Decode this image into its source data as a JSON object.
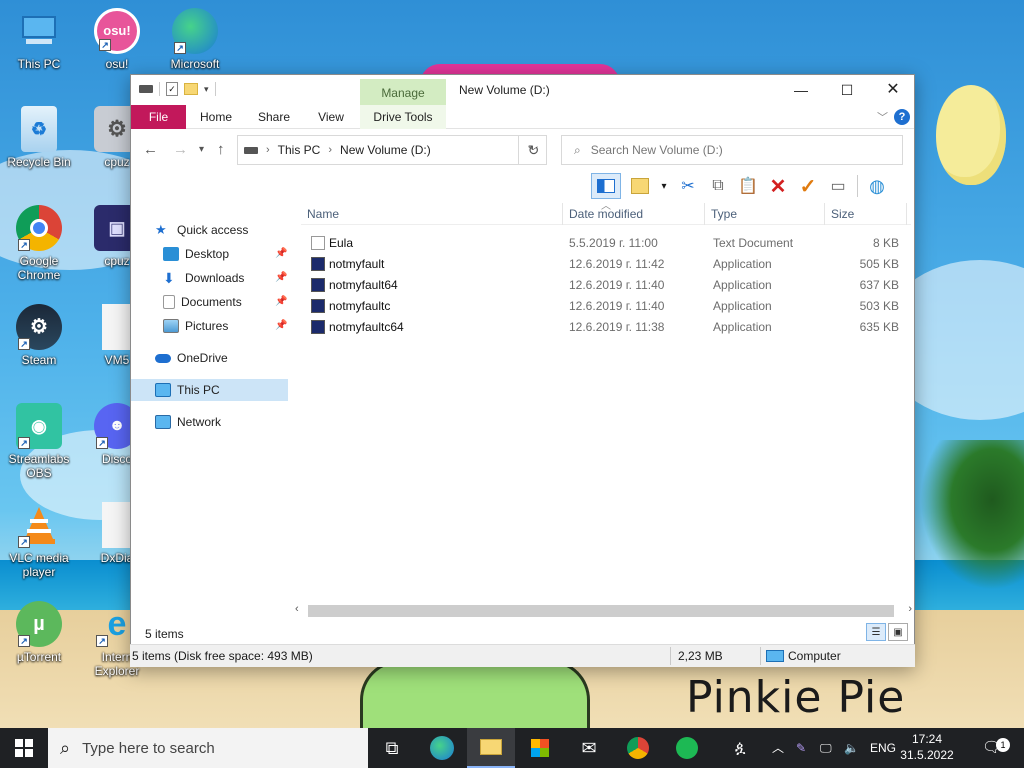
{
  "desktop": {
    "brand_text": "Pinkie Pie",
    "icons": [
      {
        "label": "This PC",
        "icon": "this-pc-icon"
      },
      {
        "label": "osu!",
        "icon": "osu-icon",
        "badge": "osu!"
      },
      {
        "label": "Microsoft",
        "icon": "edge-icon"
      },
      {
        "label": "Recycle Bin",
        "icon": "recycle-bin-icon"
      },
      {
        "label": "cpuz",
        "icon": "cpuz-icon"
      },
      {
        "label": "Google Chrome",
        "icon": "chrome-icon"
      },
      {
        "label": "cpuz",
        "icon": "cpuz-icon"
      },
      {
        "label": "Steam",
        "icon": "steam-icon"
      },
      {
        "label": "VM5",
        "icon": "document-icon"
      },
      {
        "label": "Streamlabs OBS",
        "icon": "streamlabs-icon"
      },
      {
        "label": "Disco",
        "icon": "discord-icon"
      },
      {
        "label": "VLC media player",
        "icon": "vlc-icon"
      },
      {
        "label": "DxDia",
        "icon": "document-icon"
      },
      {
        "label": "µTorrent",
        "icon": "utorrent-icon"
      },
      {
        "label": "Intern Explorer",
        "icon": "ie-icon"
      }
    ]
  },
  "explorer": {
    "window_title": "New Volume (D:)",
    "manage_label": "Manage",
    "ribbon_tabs": [
      "File",
      "Home",
      "Share",
      "View",
      "Drive Tools"
    ],
    "help_label": "?",
    "address": {
      "root": "This PC",
      "current": "New Volume (D:)"
    },
    "search_placeholder": "Search New Volume (D:)",
    "nav": {
      "quick_access": "Quick access",
      "desktop": "Desktop",
      "downloads": "Downloads",
      "documents": "Documents",
      "pictures": "Pictures",
      "onedrive": "OneDrive",
      "this_pc": "This PC",
      "network": "Network"
    },
    "columns": {
      "name": "Name",
      "date": "Date modified",
      "type": "Type",
      "size": "Size"
    },
    "files": [
      {
        "name": "Eula",
        "date": "5.5.2019 г. 11:00",
        "type": "Text Document",
        "size": "8 KB",
        "icon": "text-file-icon"
      },
      {
        "name": "notmyfault",
        "date": "12.6.2019 г. 11:42",
        "type": "Application",
        "size": "505 KB",
        "icon": "application-icon"
      },
      {
        "name": "notmyfault64",
        "date": "12.6.2019 г. 11:40",
        "type": "Application",
        "size": "637 KB",
        "icon": "application-icon"
      },
      {
        "name": "notmyfaultc",
        "date": "12.6.2019 г. 11:40",
        "type": "Application",
        "size": "503 KB",
        "icon": "application-icon"
      },
      {
        "name": "notmyfaultc64",
        "date": "12.6.2019 г. 11:38",
        "type": "Application",
        "size": "635 KB",
        "icon": "application-icon"
      }
    ],
    "item_count": "5 items",
    "status": {
      "items": "5 items (Disk free space: 493 MB)",
      "size": "2,23 MB",
      "location": "Computer"
    }
  },
  "taskbar": {
    "search_placeholder": "Type here to search",
    "language": "ENG",
    "time": "17:24",
    "date": "31.5.2022 г.",
    "notification_count": "1"
  },
  "colors": {
    "file_tab": "#c2185b",
    "manage_tab": "#d3ecc2",
    "selected": "#cce4f7",
    "taskbar": "#1f2124"
  }
}
